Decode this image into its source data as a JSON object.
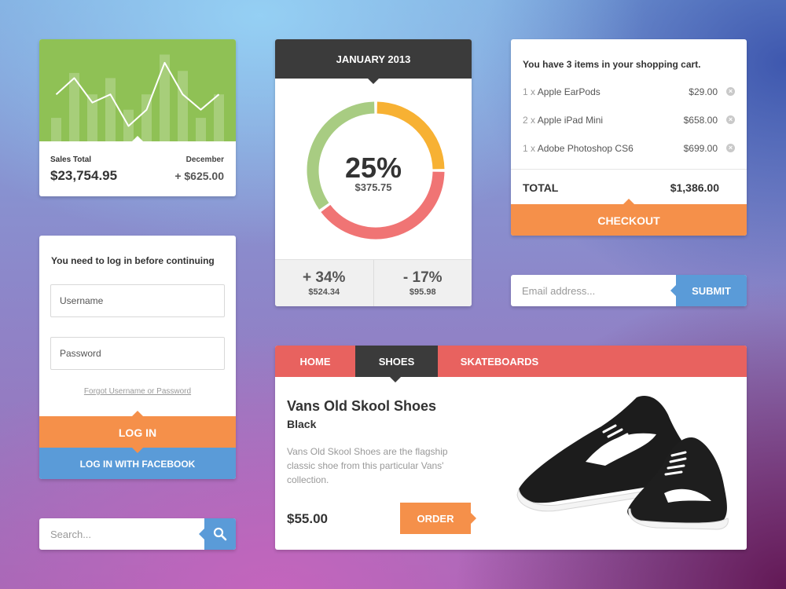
{
  "sales": {
    "label": "Sales Total",
    "value": "$23,754.95",
    "period_label": "December",
    "period_value": "+ $625.00",
    "accent": "#8fc155",
    "bar_levels": [
      0.23,
      0.67,
      0.46,
      0.62,
      0.31,
      0.46,
      0.85,
      0.69,
      0.23,
      0.46
    ],
    "line_levels": [
      0.46,
      0.62,
      0.38,
      0.46,
      0.15,
      0.31,
      0.77,
      0.46,
      0.31,
      0.46
    ]
  },
  "donut": {
    "header": "JANUARY 2013",
    "percent": "25%",
    "amount": "$375.75",
    "segments": [
      {
        "color": "#f7b133",
        "fraction": 0.25
      },
      {
        "color": "#f07474",
        "fraction": 0.4
      },
      {
        "color": "#a8cc82",
        "fraction": 0.35
      }
    ],
    "stats": [
      {
        "change": "+ 34%",
        "amount": "$524.34"
      },
      {
        "change": "- 17%",
        "amount": "$95.98"
      }
    ]
  },
  "cart": {
    "title": "You have 3 items in your shopping cart.",
    "items": [
      {
        "qty": "1 x",
        "name": "Apple EarPods",
        "price": "$29.00"
      },
      {
        "qty": "2 x",
        "name": "Apple iPad Mini",
        "price": "$658.00"
      },
      {
        "qty": "1 x",
        "name": "Adobe Photoshop CS6",
        "price": "$699.00"
      }
    ],
    "remove_icon": "×",
    "total_label": "TOTAL",
    "total_value": "$1,386.00",
    "checkout_label": "CHECKOUT"
  },
  "login": {
    "title": "You need to log in before continuing",
    "username_placeholder": "Username",
    "password_placeholder": "Password",
    "forgot_link": "Forgot Username or Password",
    "login_button": "LOG IN",
    "facebook_button": "LOG IN WITH FACEBOOK"
  },
  "search": {
    "placeholder": "Search...",
    "icon": "search-icon"
  },
  "email": {
    "placeholder": "Email address...",
    "submit_label": "SUBMIT"
  },
  "product": {
    "tabs": [
      {
        "label": "HOME",
        "active": false
      },
      {
        "label": "SHOES",
        "active": true
      },
      {
        "label": "SKATEBOARDS",
        "active": false
      }
    ],
    "name": "Vans Old Skool Shoes",
    "variant": "Black",
    "description": "Vans Old Skool Shoes are the flagship classic shoe from this particular Vans' collection.",
    "price": "$55.00",
    "order_label": "ORDER"
  },
  "colors": {
    "orange": "#f5904a",
    "blue": "#5a9bd8",
    "red": "#e8625f",
    "dark": "#3b3b3b",
    "green": "#8fc155"
  }
}
